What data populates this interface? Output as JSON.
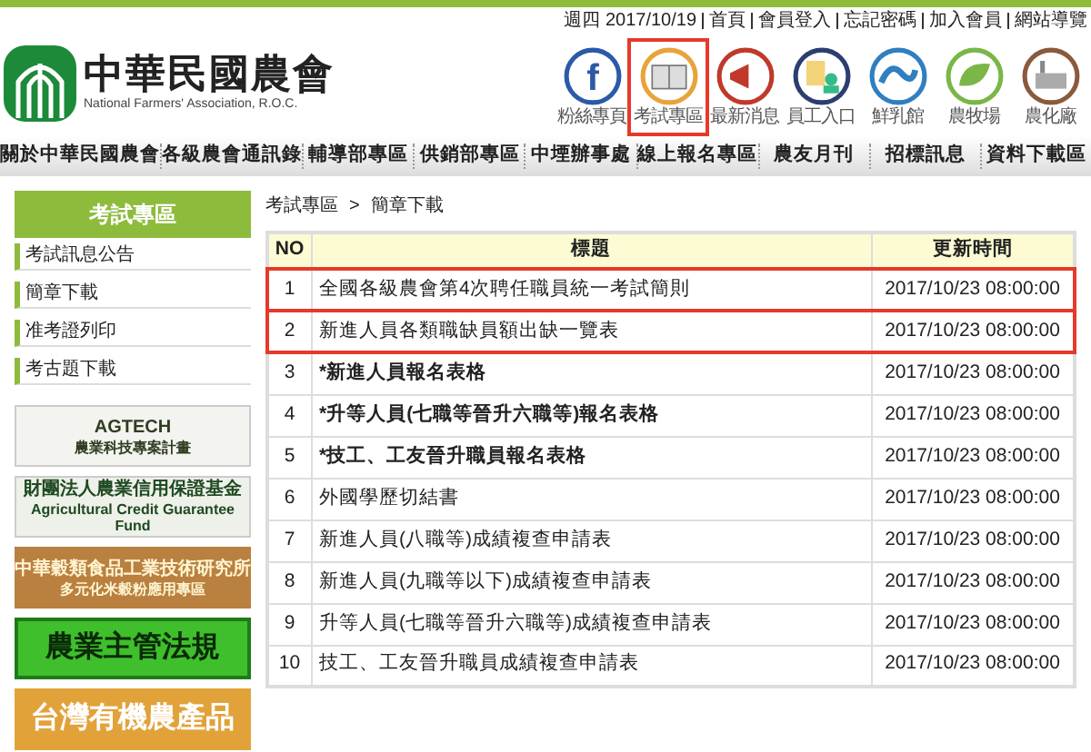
{
  "logo": {
    "title": "中華民國農會",
    "subtitle": "National Farmers' Association, R.O.C."
  },
  "top_links": [
    "週四 2017/10/19",
    "首頁",
    "會員登入",
    "忘記密碼",
    "加入會員",
    "網站導覽"
  ],
  "icon_links": [
    {
      "label": "粉絲專頁",
      "glyph": "f",
      "highlighted": false
    },
    {
      "label": "考試專區",
      "highlighted": true
    },
    {
      "label": "最新消息",
      "highlighted": false
    },
    {
      "label": "員工入口",
      "highlighted": false
    },
    {
      "label": "鮮乳館",
      "highlighted": false
    },
    {
      "label": "農牧場",
      "highlighted": false
    },
    {
      "label": "農化廠",
      "highlighted": false
    }
  ],
  "nav": [
    "關於中華民國農會",
    "各級農會通訊錄",
    "輔導部專區",
    "供銷部專區",
    "中堙辦事處",
    "線上報名專區",
    "農友月刊",
    "招標訊息",
    "資料下載區"
  ],
  "sidebar": {
    "title": "考試專區",
    "items": [
      "考試訊息公告",
      "簡章下載",
      "准考證列印",
      "考古題下載"
    ],
    "banners": [
      {
        "lines": [
          "AGTECH",
          "農業科技專案計畫"
        ]
      },
      {
        "lines": [
          "財團法人農業信用保證基金",
          "Agricultural Credit Guarantee Fund"
        ]
      },
      {
        "lines": [
          "中華穀類食品工業技術研究所",
          "多元化米穀粉應用專區"
        ]
      },
      {
        "lines": [
          "農業主管法規"
        ]
      },
      {
        "lines": [
          "台灣有機農產品"
        ]
      }
    ]
  },
  "breadcrumb": [
    "考試專區",
    "簡章下載"
  ],
  "breadcrumb_separator": ">",
  "table": {
    "columns": [
      "NO",
      "標題",
      "更新時間"
    ],
    "rows": [
      {
        "no": "1",
        "title": "全國各級農會第4次聘任職員統一考試簡則",
        "updated": "2017/10/23 08:00:00",
        "bold": false,
        "highlighted": true
      },
      {
        "no": "2",
        "title": "新進人員各類職缺員額出缺一覽表",
        "updated": "2017/10/23 08:00:00",
        "bold": false,
        "highlighted": true
      },
      {
        "no": "3",
        "title": "*新進人員報名表格",
        "updated": "2017/10/23 08:00:00",
        "bold": true,
        "highlighted": false
      },
      {
        "no": "4",
        "title": "*升等人員(七職等晉升六職等)報名表格",
        "updated": "2017/10/23 08:00:00",
        "bold": true,
        "highlighted": false
      },
      {
        "no": "5",
        "title": "*技工、工友晉升職員報名表格",
        "updated": "2017/10/23 08:00:00",
        "bold": true,
        "highlighted": false
      },
      {
        "no": "6",
        "title": "外國學歷切結書",
        "updated": "2017/10/23 08:00:00",
        "bold": false,
        "highlighted": false
      },
      {
        "no": "7",
        "title": "新進人員(八職等)成績複查申請表",
        "updated": "2017/10/23 08:00:00",
        "bold": false,
        "highlighted": false
      },
      {
        "no": "8",
        "title": "新進人員(九職等以下)成績複查申請表",
        "updated": "2017/10/23 08:00:00",
        "bold": false,
        "highlighted": false
      },
      {
        "no": "9",
        "title": "升等人員(七職等晉升六職等)成績複查申請表",
        "updated": "2017/10/23 08:00:00",
        "bold": false,
        "highlighted": false
      },
      {
        "no": "10",
        "title": "技工、工友晉升職員成績複查申請表",
        "updated": "2017/10/23 08:00:00",
        "bold": false,
        "highlighted": false
      }
    ]
  }
}
